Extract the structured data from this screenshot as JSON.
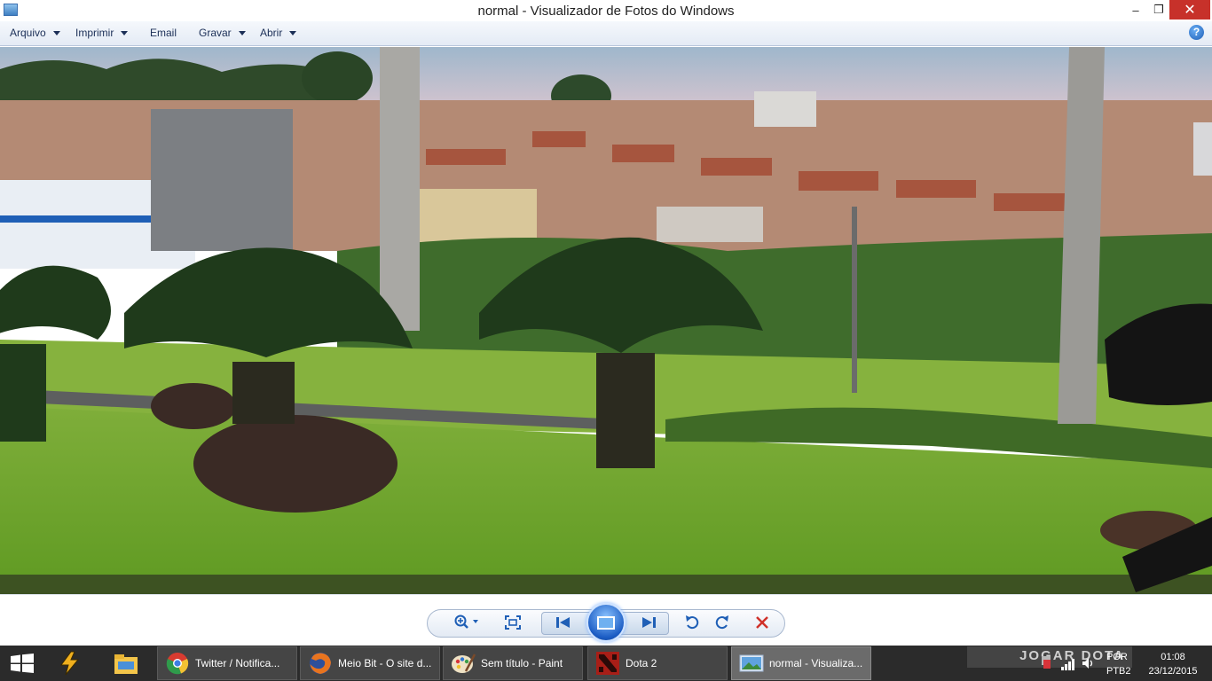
{
  "window": {
    "title": "normal - Visualizador de Fotos do Windows",
    "minimize_glyph": "–",
    "maximize_glyph": "❐",
    "close_glyph": "✕"
  },
  "menu": {
    "items": [
      {
        "label": "Arquivo",
        "has_dropdown": true
      },
      {
        "label": "Imprimir",
        "has_dropdown": true
      },
      {
        "label": "Email",
        "has_dropdown": false
      },
      {
        "label": "Gravar",
        "has_dropdown": true
      },
      {
        "label": "Abrir",
        "has_dropdown": true
      }
    ],
    "help_glyph": "?"
  },
  "photo": {
    "subject": "outdoor-city-photo"
  },
  "controls": {
    "zoom_icon": "zoom-icon",
    "actual_size_icon": "actual-size-icon",
    "previous_icon": "previous-icon",
    "slideshow_icon": "slideshow-icon",
    "next_icon": "next-icon",
    "rotate_ccw_icon": "rotate-counterclockwise-icon",
    "rotate_cw_icon": "rotate-clockwise-icon",
    "delete_icon": "delete-icon"
  },
  "taskbar": {
    "tasks": [
      {
        "label": "Twitter / Notifica...",
        "icon": "chrome-icon",
        "active": false
      },
      {
        "label": "Meio Bit - O site d...",
        "icon": "firefox-icon",
        "active": false
      },
      {
        "label": "Sem título - Paint",
        "icon": "paint-icon",
        "active": false
      },
      {
        "label": "Dota 2",
        "icon": "dota-icon",
        "active": false
      },
      {
        "label": "normal - Visualiza...",
        "icon": "photo-viewer-icon",
        "active": true
      }
    ],
    "pinned": [
      "winamp-icon",
      "file-explorer-icon"
    ],
    "watermark": "JOGAR DOTA",
    "tray": {
      "language": "POR",
      "layout": "PTB2",
      "time": "01:08",
      "date": "23/12/2015"
    }
  },
  "colors": {
    "accent": "#1f5fb6",
    "close_red": "#c7312a",
    "taskbar": "#2b2b2b"
  }
}
